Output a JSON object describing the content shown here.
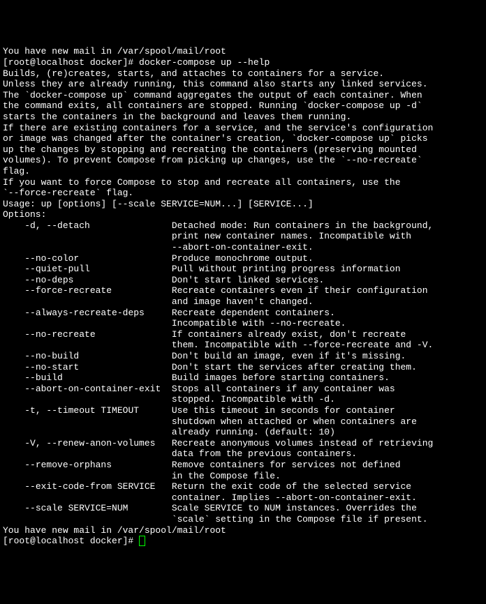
{
  "top_lines": [
    "You have new mail in /var/spool/mail/root",
    "[root@localhost docker]# docker-compose up --help",
    "Builds, (re)creates, starts, and attaches to containers for a service.",
    "",
    "Unless they are already running, this command also starts any linked services.",
    "",
    "The `docker-compose up` command aggregates the output of each container. When",
    "the command exits, all containers are stopped. Running `docker-compose up -d`",
    "starts the containers in the background and leaves them running.",
    "",
    "If there are existing containers for a service, and the service's configuration",
    "or image was changed after the container's creation, `docker-compose up` picks",
    "up the changes by stopping and recreating the containers (preserving mounted",
    "volumes). To prevent Compose from picking up changes, use the `--no-recreate`",
    "flag.",
    "",
    "If you want to force Compose to stop and recreate all containers, use the",
    "`--force-recreate` flag.",
    "",
    "Usage: up [options] [--scale SERVICE=NUM...] [SERVICE...]",
    "",
    "Options:",
    "    -d, --detach               Detached mode: Run containers in the background,",
    "                               print new container names. Incompatible with",
    "                               --abort-on-container-exit.",
    "    --no-color                 Produce monochrome output.",
    "    --quiet-pull               Pull without printing progress information",
    "    --no-deps                  Don't start linked services.",
    "    --force-recreate           Recreate containers even if their configuration",
    "                               and image haven't changed.",
    "    --always-recreate-deps     Recreate dependent containers.",
    "                               Incompatible with --no-recreate.",
    "    --no-recreate              If containers already exist, don't recreate",
    "                               them. Incompatible with --force-recreate and -V.",
    "    --no-build                 Don't build an image, even if it's missing.",
    "    --no-start                 Don't start the services after creating them.",
    "    --build                    Build images before starting containers.",
    "    --abort-on-container-exit  Stops all containers if any container was",
    "                               stopped. Incompatible with -d.",
    "    -t, --timeout TIMEOUT      Use this timeout in seconds for container",
    "                               shutdown when attached or when containers are",
    "                               already running. (default: 10)",
    "    -V, --renew-anon-volumes   Recreate anonymous volumes instead of retrieving",
    "                               data from the previous containers.",
    "    --remove-orphans           Remove containers for services not defined",
    "                               in the Compose file.",
    "    --exit-code-from SERVICE   Return the exit code of the selected service",
    "                               container. Implies --abort-on-container-exit.",
    "    --scale SERVICE=NUM        Scale SERVICE to NUM instances. Overrides the",
    "                               `scale` setting in the Compose file if present.",
    "You have new mail in /var/spool/mail/root"
  ],
  "prompt": "[root@localhost docker]# "
}
